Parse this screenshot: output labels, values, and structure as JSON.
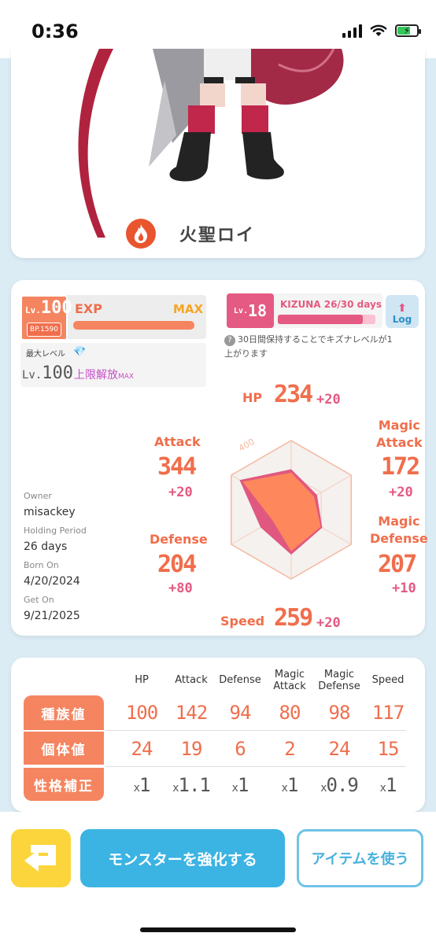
{
  "status_bar": {
    "time": "0:36"
  },
  "character": {
    "name": "火聖ロイ",
    "element_icon": "fire-icon"
  },
  "level": {
    "lv_prefix": "Lv.",
    "lv_value": "100",
    "bp": "BP.1590",
    "exp_label": "EXP",
    "exp_status": "MAX",
    "exp_progress": 1.0,
    "max_level_label": "最大レベル",
    "max_level_prefix": "Lv.",
    "max_level_value": "100",
    "limit_break_text": "上限解放",
    "limit_break_suffix": "MAX"
  },
  "kizuna": {
    "lv_prefix": "Lv.",
    "lv_value": "18",
    "label": "KIZUNA  26/30 days",
    "progress": 0.867,
    "log_label": "Log",
    "note": "30日間保持することでキズナレベルが1上がります"
  },
  "info": {
    "owner_label": "Owner",
    "owner_value": "misackey",
    "holding_label": "Holding Period",
    "holding_value": "26 days",
    "born_label": "Born On",
    "born_value": "4/20/2024",
    "get_label": "Get On",
    "get_value": "9/21/2025"
  },
  "stats": {
    "hp": {
      "name": "HP",
      "value": "234",
      "bonus": "+20"
    },
    "attack": {
      "name": "Attack",
      "value": "344",
      "bonus": "+20"
    },
    "magic_attack": {
      "name_line1": "Magic",
      "name_line2": "Attack",
      "value": "172",
      "bonus": "+20"
    },
    "magic_defense": {
      "name_line1": "Magic",
      "name_line2": "Defense",
      "value": "207",
      "bonus": "+10"
    },
    "defense": {
      "name": "Defense",
      "value": "204",
      "bonus": "+80"
    },
    "speed": {
      "name": "Speed",
      "value": "259",
      "bonus": "+20"
    },
    "radar_max_label": "400",
    "radar_max": 400
  },
  "table": {
    "headers": [
      "HP",
      "Attack",
      "Defense",
      "Magic Attack",
      "Magic Defense",
      "Speed"
    ],
    "header_lines": [
      [
        "HP"
      ],
      [
        "Attack"
      ],
      [
        "Defense"
      ],
      [
        "Magic",
        "Attack"
      ],
      [
        "Magic",
        "Defense"
      ],
      [
        "Speed"
      ]
    ],
    "rows": [
      {
        "label": "種族値",
        "values": [
          "100",
          "142",
          "94",
          "80",
          "98",
          "117"
        ]
      },
      {
        "label": "個体値",
        "values": [
          "24",
          "19",
          "6",
          "2",
          "24",
          "15"
        ]
      },
      {
        "label": "性格補正",
        "values": [
          "1",
          "1.1",
          "1",
          "1",
          "0.9",
          "1"
        ],
        "prefix": "x"
      }
    ]
  },
  "buttons": {
    "enhance": "モンスターを強化する",
    "use_item": "アイテムを使う"
  },
  "colors": {
    "accent": "#f58560",
    "kizuna": "#e45a82",
    "primary_button": "#3bb3e3",
    "back_button": "#fbd53b"
  }
}
